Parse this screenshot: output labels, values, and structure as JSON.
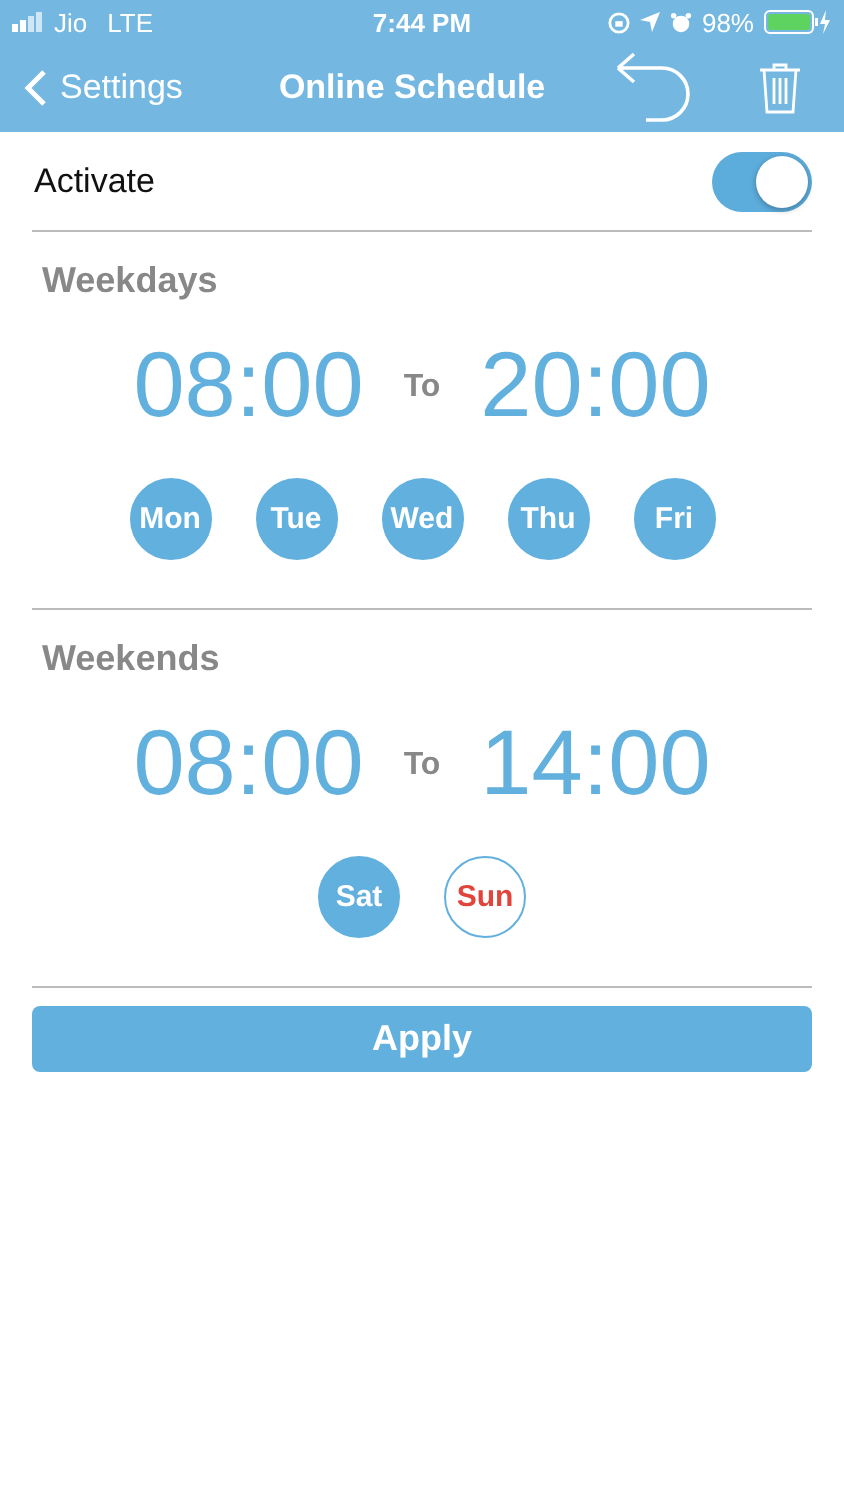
{
  "status_bar": {
    "carrier": "Jio",
    "network": "LTE",
    "time": "7:44 PM",
    "battery": "98%"
  },
  "nav": {
    "back": "Settings",
    "title": "Online Schedule"
  },
  "activate": {
    "label": "Activate",
    "on": true
  },
  "sections": [
    {
      "title": "Weekdays",
      "from": "08:00",
      "separator": "To",
      "to": "20:00",
      "days": [
        {
          "label": "Mon",
          "selected": true
        },
        {
          "label": "Tue",
          "selected": true
        },
        {
          "label": "Wed",
          "selected": true
        },
        {
          "label": "Thu",
          "selected": true
        },
        {
          "label": "Fri",
          "selected": true
        }
      ]
    },
    {
      "title": "Weekends",
      "from": "08:00",
      "separator": "To",
      "to": "14:00",
      "days": [
        {
          "label": "Sat",
          "selected": true
        },
        {
          "label": "Sun",
          "selected": false
        }
      ]
    }
  ],
  "apply_button": "Apply"
}
